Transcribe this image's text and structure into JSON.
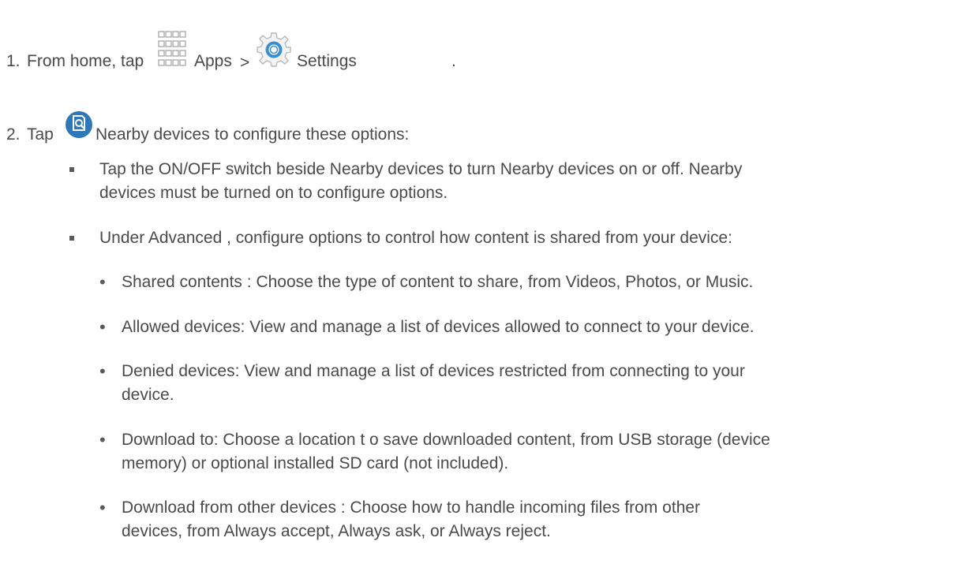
{
  "steps": [
    {
      "number": "1.",
      "parts": {
        "lead": "From home, tap",
        "apps_label": "Apps",
        "sep": ">",
        "settings_label": "Settings",
        "end": "."
      },
      "icons": [
        "apps-grid-icon",
        "settings-gear-icon"
      ]
    },
    {
      "number": "2.",
      "parts": {
        "lead": "Tap",
        "nearby_label": "Nearby devices",
        "rest": "to configure these options:"
      },
      "icons": [
        "nearby-devices-icon"
      ]
    }
  ],
  "bullets": [
    {
      "line1": "Tap the ON/OFF switch beside Nearby devices  to turn Nearby devices on or off. Nearby",
      "line2": "devices must be turned on to configure options."
    },
    {
      "line1": "Under Advanced , configure options to control how content is shared from your device:"
    }
  ],
  "sub_bullets": [
    {
      "line1": "Shared contents  : Choose the type of content to share, from Videos, Photos, or Music."
    },
    {
      "line1": "Allowed devices: View and manage a list of devices allowed to connect to your device."
    },
    {
      "line1": "Denied  devices: View and manage a list of devices restricted from connecting to your",
      "line2": "device."
    },
    {
      "line1": "Download to: Choose a location t  o save downloaded content, from USB storage (device",
      "line2": "memory) or optional installed SD card (not included)."
    },
    {
      "line1": "Download  from other devices   : Choose how to handle incoming files from other",
      "line2": "devices, from Always accept, Always ask, or Always reject."
    }
  ],
  "colors": {
    "text": "#4a4a4a",
    "nearby_icon_bg": "#2e78b7",
    "settings_icon": "#3a8fd0",
    "apps_icon": "#a0a0a0"
  }
}
